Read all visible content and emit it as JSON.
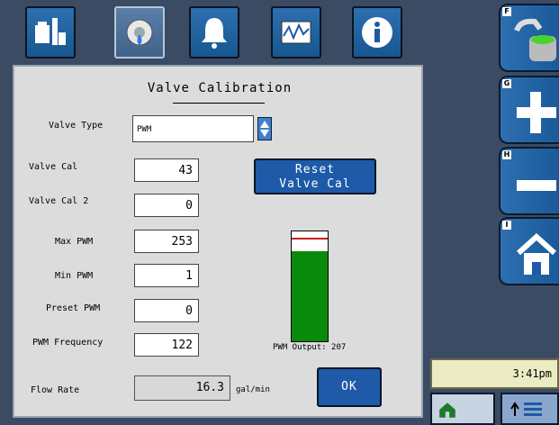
{
  "panel": {
    "title": "Valve Calibration",
    "valve_type_label": "Valve Type",
    "valve_type_value": "PWM",
    "fields": [
      {
        "label": "Valve Cal",
        "value": "43"
      },
      {
        "label": "Valve Cal 2",
        "value": "0"
      },
      {
        "label": "Max PWM",
        "value": "253"
      },
      {
        "label": "Min PWM",
        "value": "1"
      },
      {
        "label": "Preset PWM",
        "value": "0"
      },
      {
        "label": "PWM Frequency",
        "value": "122"
      }
    ],
    "reset_label_1": "Reset",
    "reset_label_2": "Valve Cal",
    "pwm_output_label": "PWM Output: 207",
    "pwm_output_fraction": 0.82,
    "flow_rate_label": "Flow Rate",
    "flow_rate_value": "16.3",
    "flow_rate_units": "gal/min",
    "ok_label": "OK"
  },
  "right_keys": [
    "F",
    "G",
    "H",
    "I"
  ],
  "clock": "3:41pm",
  "colors": {
    "accent": "#1e5aa8",
    "fill_green": "#0a8a0a",
    "panel": "#dcdcdc"
  },
  "icons": [
    "tools-icon",
    "gear-droplet-icon",
    "bell-icon",
    "waveform-icon",
    "info-icon",
    "tank-fill-icon",
    "plus-icon",
    "minus-icon",
    "home-icon"
  ]
}
